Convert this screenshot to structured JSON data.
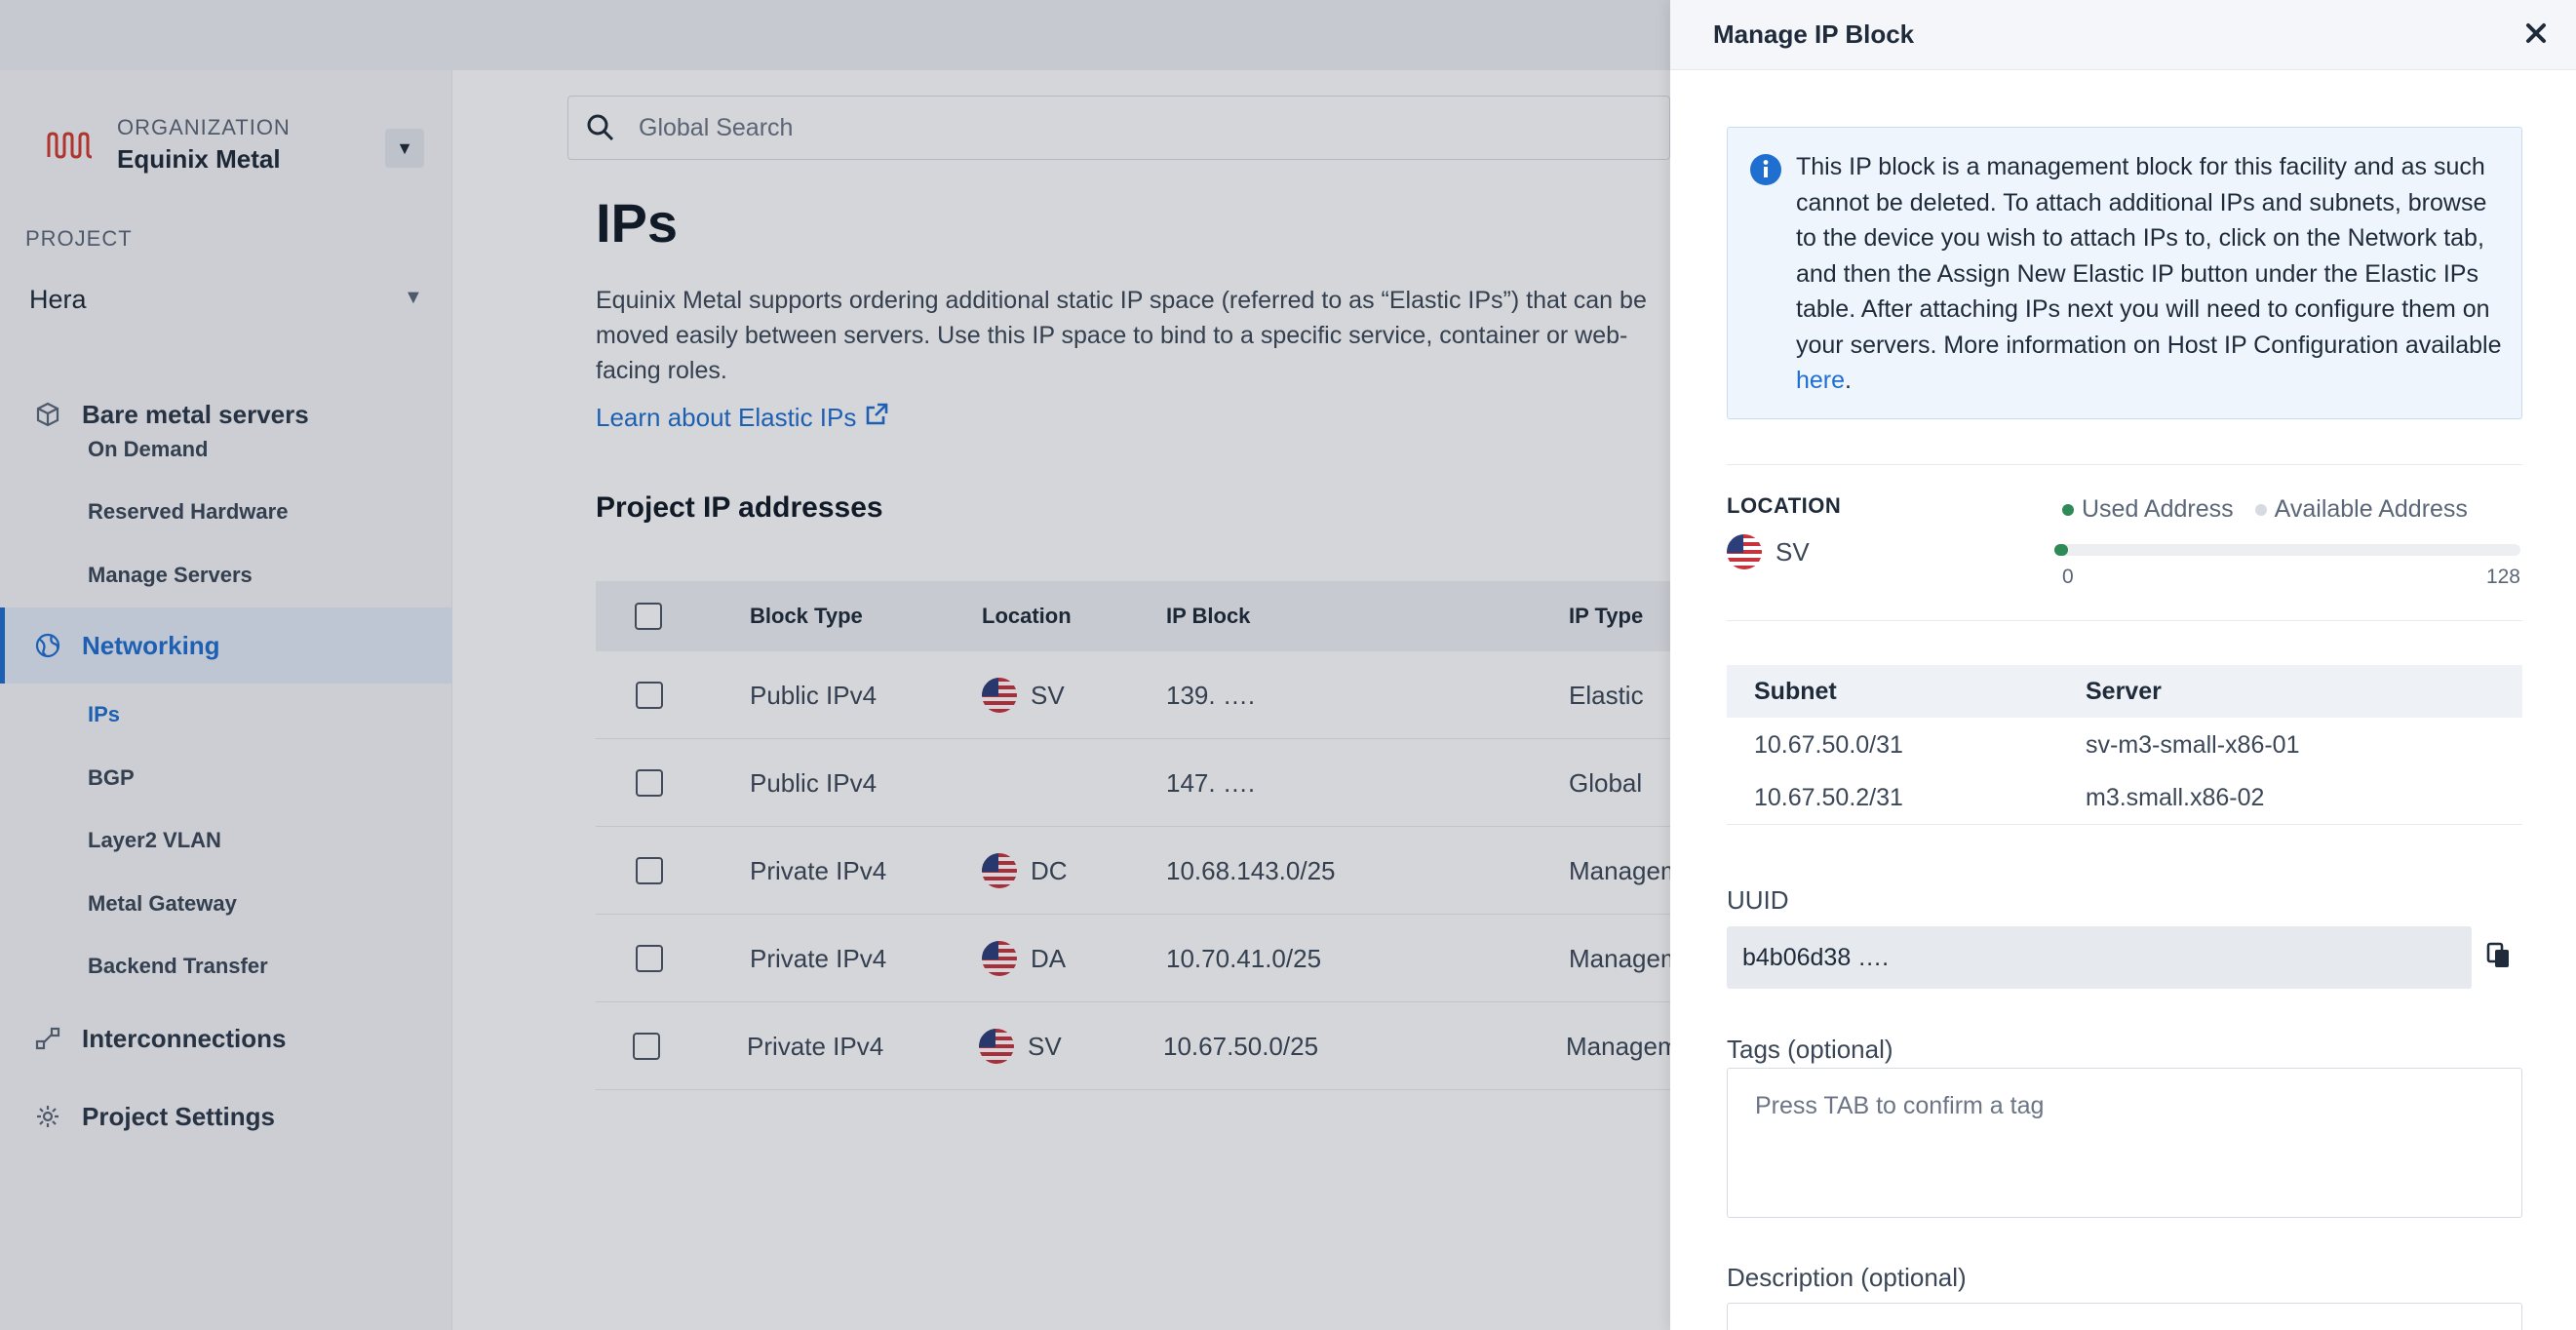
{
  "sidebar": {
    "org_label": "ORGANIZATION",
    "org_name": "Equinix Metal",
    "project_label": "PROJECT",
    "project_name": "Hera",
    "sections": [
      {
        "label": "Bare metal servers",
        "icon": "cube-icon"
      },
      {
        "label": "Networking",
        "icon": "globe-icon",
        "active": true
      },
      {
        "label": "Interconnections",
        "icon": "interconnect-icon"
      },
      {
        "label": "Project Settings",
        "icon": "gear-icon"
      }
    ],
    "bare_metal_items": [
      "On Demand",
      "Reserved Hardware",
      "Manage Servers"
    ],
    "networking_items": [
      "IPs",
      "BGP",
      "Layer2 VLAN",
      "Metal Gateway",
      "Backend Transfer"
    ]
  },
  "search": {
    "placeholder": "Global Search",
    "icon": "search-icon"
  },
  "main": {
    "title": "IPs",
    "description": "Equinix Metal supports ordering additional static IP space (referred to as “Elastic IPs”) that can be moved easily between servers. Use this IP space to bind to a specific service, container or web-facing roles.",
    "learn_link": "Learn about Elastic IPs",
    "section_title": "Project IP addresses",
    "table": {
      "headers": [
        "Block Type",
        "Location",
        "IP Block",
        "IP Type"
      ],
      "rows": [
        {
          "block_type": "Public IPv4",
          "location": "SV",
          "ip_block": "139. ….",
          "ip_type": "Elastic"
        },
        {
          "block_type": "Public IPv4",
          "location": "",
          "ip_block": "147. ….",
          "ip_type": "Global"
        },
        {
          "block_type": "Private IPv4",
          "location": "DC",
          "ip_block": "10.68.143.0/25",
          "ip_type": "Management"
        },
        {
          "block_type": "Private IPv4",
          "location": "DA",
          "ip_block": "10.70.41.0/25",
          "ip_type": "Management"
        },
        {
          "block_type": "Private IPv4",
          "location": "SV",
          "ip_block": "10.67.50.0/25",
          "ip_type": "Management"
        }
      ]
    }
  },
  "drawer": {
    "title": "Manage IP Block",
    "info_text": "This IP block is a management block for this facility and as such cannot be deleted. To attach additional IPs and subnets, browse to the device you wish to attach IPs to, click on the Network tab, and then the Assign New Elastic IP button under the Elastic IPs table. After attaching IPs next you will need to configure them on your servers. More information on Host IP Configuration available ",
    "info_link": "here",
    "info_end": ".",
    "location_label": "LOCATION",
    "location_value": "SV",
    "legend_used": "Used Address",
    "legend_available": "Available Address",
    "usage": {
      "used": 0,
      "min": "0",
      "max": "128"
    },
    "subnet_table": {
      "headers": [
        "Subnet",
        "Server"
      ],
      "rows": [
        {
          "subnet": "10.67.50.0/31",
          "server": "sv-m3-small-x86-01"
        },
        {
          "subnet": "10.67.50.2/31",
          "server": "m3.small.x86-02"
        }
      ]
    },
    "uuid_label": "UUID",
    "uuid_value": "b4b06d38  ….",
    "tags_label": "Tags (optional)",
    "tags_placeholder": "Press TAB to confirm a tag",
    "description_label": "Description (optional)"
  },
  "colors": {
    "accent": "#1f6fd1",
    "brand_red": "#d23a2e",
    "used_dot": "#2e8b57",
    "available_dot": "#d7dbe1"
  }
}
